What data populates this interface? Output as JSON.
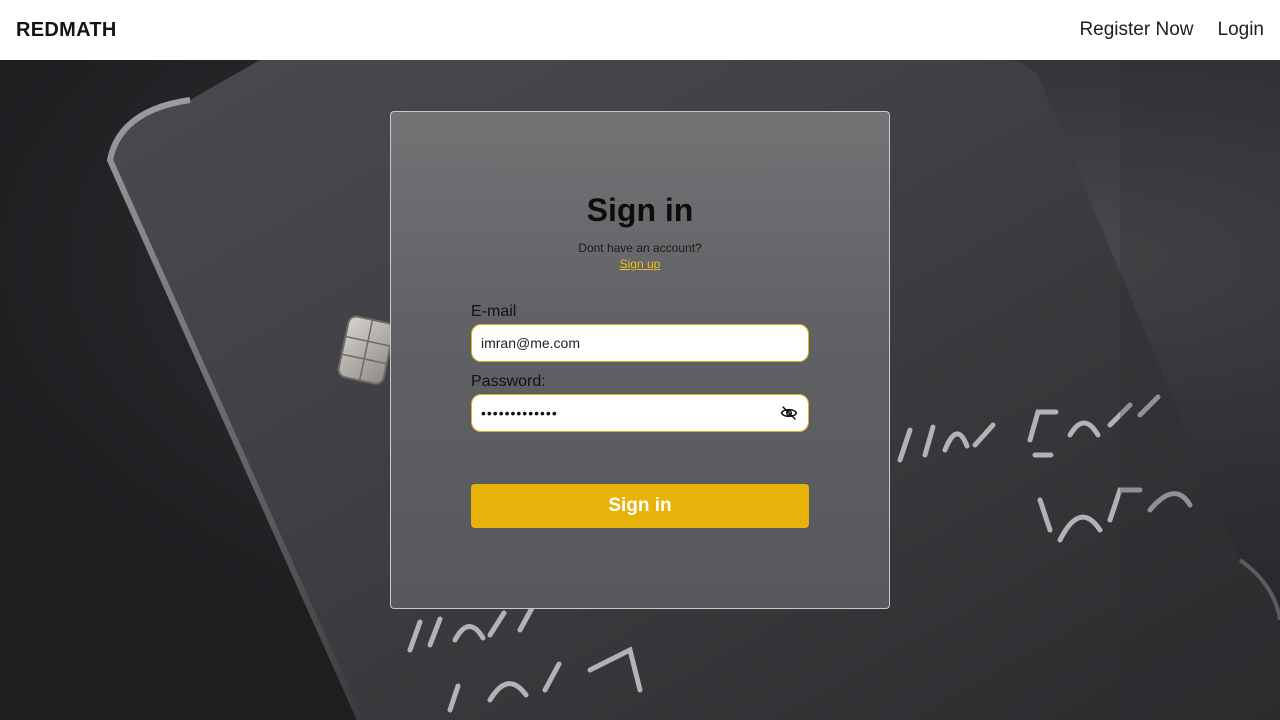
{
  "navbar": {
    "brand": "REDMATH",
    "links": [
      {
        "label": "Register Now"
      },
      {
        "label": "Login"
      }
    ]
  },
  "form": {
    "title": "Sign in",
    "subtitle": "Dont have an account?",
    "signup_link": "Sign up",
    "email": {
      "label": "E-mail",
      "value": "imran@me.com"
    },
    "password": {
      "label": "Password:",
      "value": "•••••••••••••",
      "toggle_icon": "eye-slash-icon"
    },
    "submit_label": "Sign in"
  },
  "colors": {
    "accent": "#e8b20a",
    "link": "#f2bd1a",
    "navbar_bg": "#ffffff"
  }
}
